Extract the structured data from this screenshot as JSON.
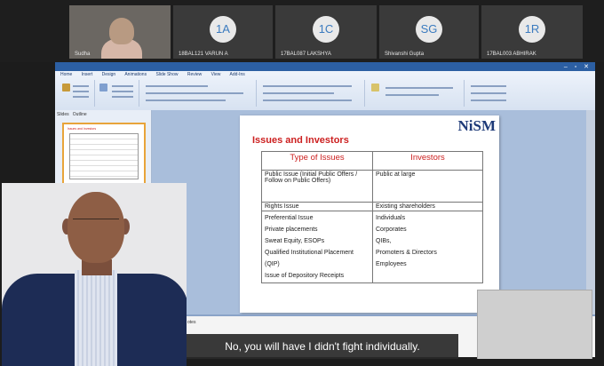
{
  "participants": [
    {
      "initials": "",
      "name": "Sudha",
      "video": true
    },
    {
      "initials": "1A",
      "name": "18BAL121 VARUN A",
      "video": false
    },
    {
      "initials": "1C",
      "name": "17BAL087 LAKSHYA",
      "video": false
    },
    {
      "initials": "SG",
      "name": "Shivanshi Gupta",
      "video": false
    },
    {
      "initials": "1R",
      "name": "17BAL003 ABHIRAK",
      "video": false
    }
  ],
  "powerpoint": {
    "window_title": "",
    "ribbon_tabs": [
      "Home",
      "Insert",
      "Design",
      "Animations",
      "Slide Show",
      "Review",
      "View",
      "Add-Ins"
    ],
    "pane_tabs": [
      "Slides",
      "Outline"
    ],
    "notes_label": "otes"
  },
  "slide": {
    "logo": "NiSM",
    "title": "Issues and Investors",
    "table": {
      "headers": [
        "Type of Issues",
        "Investors"
      ],
      "rows": [
        [
          "Public Issue (Initial Public Offers / Follow on Public Offers)",
          "Public at large"
        ],
        [
          "Rights Issue",
          "Existing shareholders"
        ],
        [
          "Preferential Issue",
          "Individuals"
        ],
        [
          "Private placements",
          "Corporates"
        ],
        [
          "Sweat Equity, ESOPs",
          "QIBs,"
        ],
        [
          "Qualified Institutional Placement (QIP)",
          "Promoters & Directors"
        ],
        [
          "",
          "Employees"
        ],
        [
          "Issue of Depository Receipts",
          ""
        ]
      ]
    }
  },
  "caption": "No, you will have I didn't fight individually.",
  "colors": {
    "accent": "#2c5fa3",
    "slide_title": "#cc1f1f",
    "avatar_text": "#3b7bbf"
  }
}
